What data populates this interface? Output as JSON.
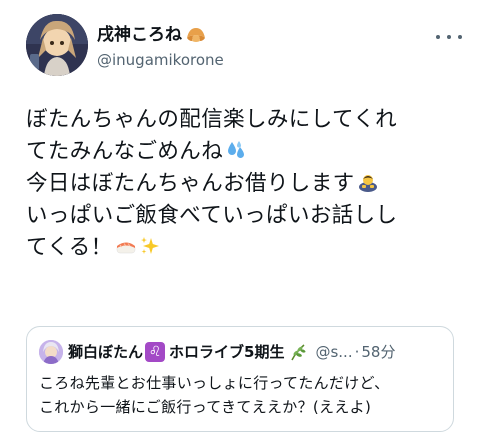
{
  "author": {
    "display_name": "戌神ころね",
    "name_emoji": "croissant-emoji",
    "handle": "@inugamikorone"
  },
  "more_menu": {
    "icon": "more-horizontal-icon"
  },
  "tweet": {
    "lines": [
      "ぼたんちゃんの配信楽しみにしてくれ",
      "てたみんなごめんね",
      "今日はぼたんちゃんお借りします",
      "いっぱいご飯食べていっぱいお話しし",
      "てくる！"
    ],
    "emojis": {
      "line2": "sweat-droplets-emoji",
      "line3": "bowing-person-emoji",
      "line5a": "sushi-emoji",
      "line5b": "sparkles-emoji"
    }
  },
  "quote": {
    "name_part1": "獅白ぼたん",
    "zodiac": "♌",
    "name_part2": "ホロライブ5期生",
    "leaf_emoji": "herb-emoji",
    "handle": "@s...",
    "separator": "·",
    "time": "58分",
    "lines": [
      "ころね先輩とお仕事いっしょに行ってたんだけど、",
      "これから一緒にご飯行ってきてええか？(ええよ)"
    ]
  },
  "colors": {
    "text": "#0f1419",
    "secondary": "#536471",
    "border": "#cfd9de"
  }
}
